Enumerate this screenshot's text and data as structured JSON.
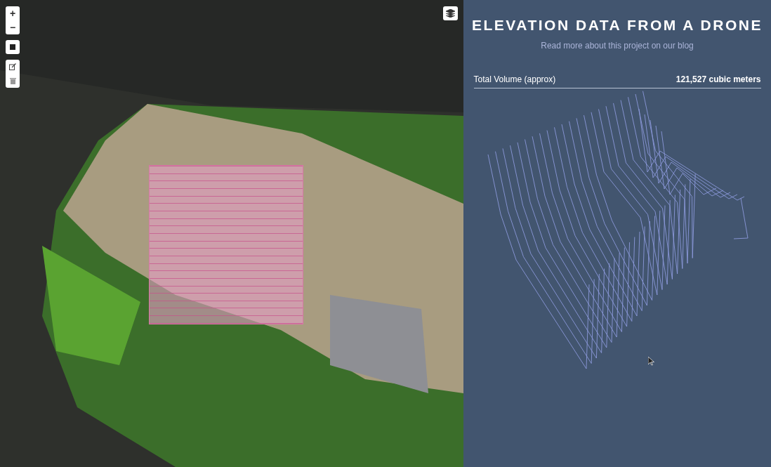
{
  "map": {
    "zoom_in": "+",
    "zoom_out": "−"
  },
  "panel": {
    "title": "ELEVATION DATA FROM A DRONE",
    "subtitle": "Read more about this project on our blog",
    "stat": {
      "label": "Total Volume (approx)",
      "value": "121,527 cubic meters"
    }
  }
}
